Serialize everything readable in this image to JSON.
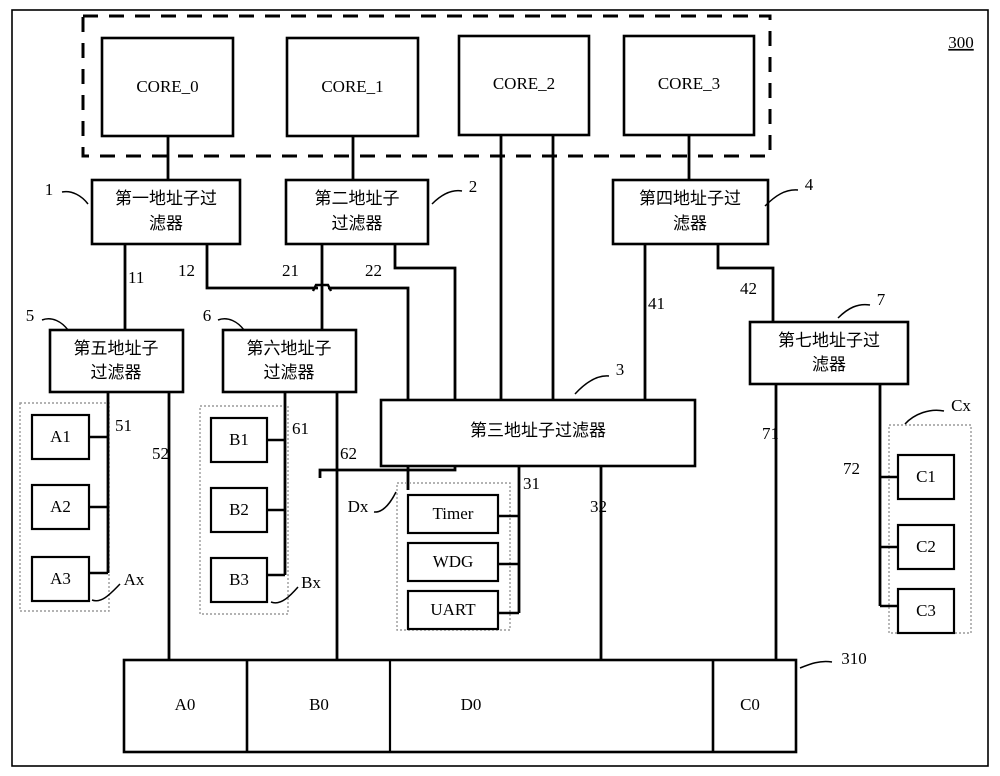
{
  "figure": {
    "ref_label": "300",
    "bus_ref_label": "310"
  },
  "cores": [
    {
      "label": "CORE_0"
    },
    {
      "label": "CORE_1"
    },
    {
      "label": "CORE_2"
    },
    {
      "label": "CORE_3"
    }
  ],
  "filters": [
    {
      "ref": "1",
      "label": "第一地址子过滤器"
    },
    {
      "ref": "2",
      "label": "第二地址子过滤器"
    },
    {
      "ref": "3",
      "label": "第三地址子过滤器"
    },
    {
      "ref": "4",
      "label": "第四地址子过滤器"
    },
    {
      "ref": "5",
      "label": "第五地址子过滤器"
    },
    {
      "ref": "6",
      "label": "第六地址子过滤器"
    },
    {
      "ref": "7",
      "label": "第七地址子过滤器"
    }
  ],
  "wire_labels": {
    "w11": "11",
    "w12": "12",
    "w21": "21",
    "w22": "22",
    "w31": "31",
    "w32": "32",
    "w41": "41",
    "w42": "42",
    "w51": "51",
    "w52": "52",
    "w61": "61",
    "w62": "62",
    "w71": "71",
    "w72": "72"
  },
  "group_labels": {
    "ax": "Ax",
    "bx": "Bx",
    "cx": "Cx",
    "dx": "Dx"
  },
  "group_a": [
    {
      "label": "A1"
    },
    {
      "label": "A2"
    },
    {
      "label": "A3"
    }
  ],
  "group_b": [
    {
      "label": "B1"
    },
    {
      "label": "B2"
    },
    {
      "label": "B3"
    }
  ],
  "group_c": [
    {
      "label": "C1"
    },
    {
      "label": "C2"
    },
    {
      "label": "C3"
    }
  ],
  "group_d": [
    {
      "label": "Timer"
    },
    {
      "label": "WDG"
    },
    {
      "label": "UART"
    }
  ],
  "bus_segments": [
    {
      "label": "A0"
    },
    {
      "label": "B0"
    },
    {
      "label": "D0"
    },
    {
      "label": "C0"
    }
  ]
}
